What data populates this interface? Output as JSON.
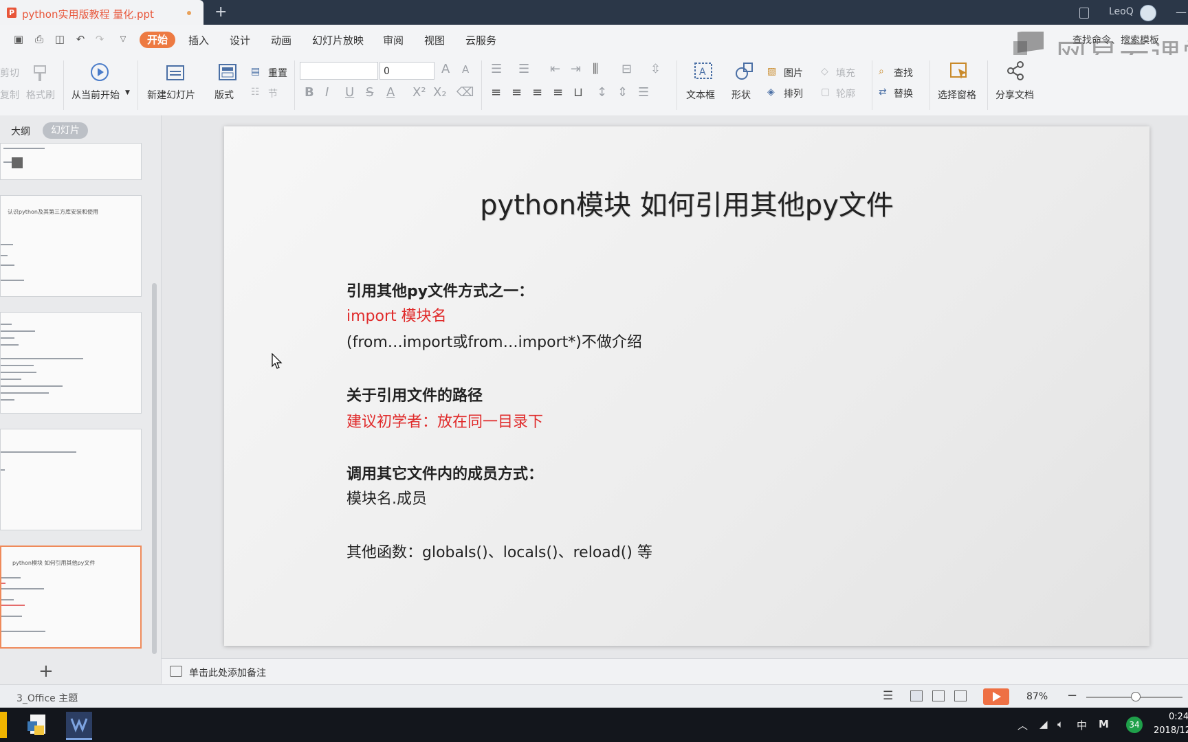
{
  "app": {
    "doc_tab_title": "python实用版教程 量化.ppt",
    "new_tab": "+",
    "user_name": "LeoQ",
    "search_cmd": "查找命令、搜索模板",
    "watermark_text": "网易云课堂"
  },
  "menu": {
    "start": "开始",
    "items": [
      "插入",
      "设计",
      "动画",
      "幻灯片放映",
      "审阅",
      "视图",
      "云服务"
    ]
  },
  "ribbon": {
    "cut": "剪切",
    "copy": "复制",
    "format_painter": "格式刷",
    "play_from_current": "从当前开始",
    "new_slide": "新建幻灯片",
    "layout": "版式",
    "reset": "重置",
    "section": "节",
    "font_name": "",
    "font_size": "0",
    "textbox": "文本框",
    "shape": "形状",
    "picture": "图片",
    "arrange": "排列",
    "fill": "填充",
    "outline": "轮廓",
    "find": "查找",
    "replace": "替换",
    "select_pane": "选择窗格",
    "share_doc": "分享文档"
  },
  "left_panel": {
    "tab_outline": "大纲",
    "tab_slides": "幻灯片",
    "thumbs": {
      "t2_title": "认识python及其第三方库安装和使用",
      "t5_title": "python模块 如何引用其他py文件"
    }
  },
  "slide": {
    "title": "python模块 如何引用其他py文件",
    "lines": [
      "引用其他py文件方式之一：",
      "import 模块名",
      "(from…import或from…import*)不做介绍",
      "关于引用文件的路径",
      "建议初学者：放在同一目录下",
      "调用其它文件内的成员方式：",
      "模块名.成员",
      "其他函数：globals()、locals()、reload() 等"
    ]
  },
  "notes": {
    "placeholder": "单击此处添加备注"
  },
  "status": {
    "theme": "3_Office 主题",
    "zoom": "87%"
  },
  "taskbar": {
    "ime": "中",
    "ime2": "M",
    "badge": "34",
    "time": "0:24",
    "date": "2018/12"
  },
  "colors": {
    "accent": "#ed7a42",
    "red_text": "#e02b2b",
    "titlebar": "#2b3748",
    "taskbar": "#13161c"
  }
}
